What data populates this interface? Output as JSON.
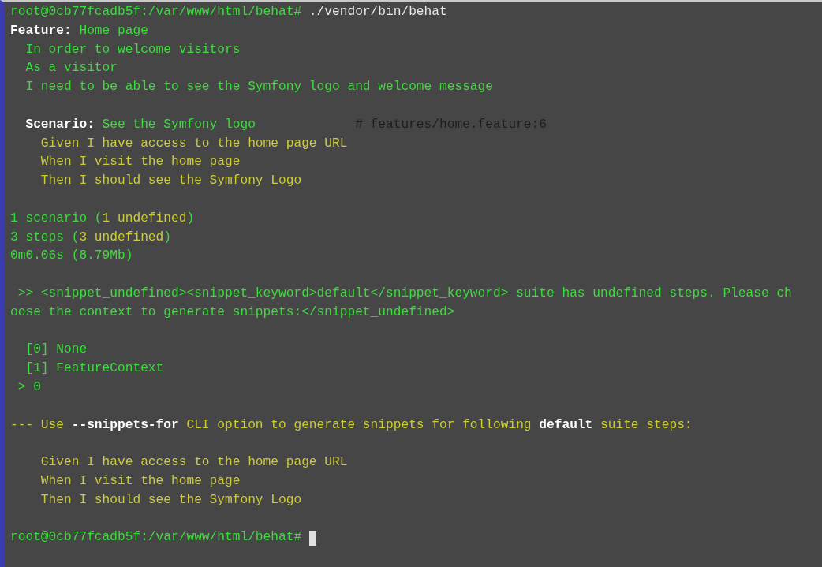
{
  "terminal": {
    "lines": [
      {
        "blank_before": false,
        "cursor": false,
        "segments": [
          {
            "kind": "green",
            "text": "root@0cb77fcadb5f:/var/www/html/behat#"
          },
          {
            "kind": "white",
            "text": " ./vendor/bin/behat"
          }
        ]
      },
      {
        "blank_before": false,
        "cursor": false,
        "segments": [
          {
            "kind": "white-bold",
            "text": "Feature:"
          },
          {
            "kind": "green",
            "text": " Home page"
          }
        ]
      },
      {
        "blank_before": false,
        "cursor": false,
        "segments": [
          {
            "kind": "green",
            "text": "  In order to welcome visitors"
          }
        ]
      },
      {
        "blank_before": false,
        "cursor": false,
        "segments": [
          {
            "kind": "green",
            "text": "  As a visitor"
          }
        ]
      },
      {
        "blank_before": false,
        "cursor": false,
        "segments": [
          {
            "kind": "green",
            "text": "  I need to be able to see the Symfony logo and welcome message"
          }
        ]
      },
      {
        "blank_before": true,
        "cursor": false,
        "segments": [
          {
            "kind": "white-bold",
            "text": "  Scenario:"
          },
          {
            "kind": "green",
            "text": " See the Symfony logo"
          },
          {
            "kind": "comment",
            "text": "             # features/home.feature:6"
          }
        ]
      },
      {
        "blank_before": false,
        "cursor": false,
        "segments": [
          {
            "kind": "yellow",
            "text": "    Given I have access to the home page URL"
          }
        ]
      },
      {
        "blank_before": false,
        "cursor": false,
        "segments": [
          {
            "kind": "yellow",
            "text": "    When I visit the home page"
          }
        ]
      },
      {
        "blank_before": false,
        "cursor": false,
        "segments": [
          {
            "kind": "yellow",
            "text": "    Then I should see the Symfony Logo"
          }
        ]
      },
      {
        "blank_before": true,
        "cursor": false,
        "segments": [
          {
            "kind": "green",
            "text": "1 scenario ("
          },
          {
            "kind": "yellow",
            "text": "1 undefined"
          },
          {
            "kind": "green",
            "text": ")"
          }
        ]
      },
      {
        "blank_before": false,
        "cursor": false,
        "segments": [
          {
            "kind": "green",
            "text": "3 steps ("
          },
          {
            "kind": "yellow",
            "text": "3 undefined"
          },
          {
            "kind": "green",
            "text": ")"
          }
        ]
      },
      {
        "blank_before": false,
        "cursor": false,
        "segments": [
          {
            "kind": "green",
            "text": "0m0.06s (8.79Mb)"
          }
        ]
      },
      {
        "blank_before": true,
        "cursor": false,
        "segments": [
          {
            "kind": "green",
            "text": " >> <snippet_undefined><snippet_keyword>default</snippet_keyword> suite has undefined steps. Please ch"
          }
        ]
      },
      {
        "blank_before": false,
        "cursor": false,
        "segments": [
          {
            "kind": "green",
            "text": "oose the context to generate snippets:</snippet_undefined>"
          }
        ]
      },
      {
        "blank_before": true,
        "cursor": false,
        "segments": [
          {
            "kind": "green",
            "text": "  [0] None"
          }
        ]
      },
      {
        "blank_before": false,
        "cursor": false,
        "segments": [
          {
            "kind": "green",
            "text": "  [1] FeatureContext"
          }
        ]
      },
      {
        "blank_before": false,
        "cursor": false,
        "segments": [
          {
            "kind": "green",
            "text": " > 0"
          }
        ]
      },
      {
        "blank_before": true,
        "cursor": false,
        "segments": [
          {
            "kind": "yellow",
            "text": "--- Use "
          },
          {
            "kind": "white-bold",
            "text": "--snippets-for"
          },
          {
            "kind": "yellow",
            "text": " CLI option to generate snippets for following "
          },
          {
            "kind": "white-bold",
            "text": "default"
          },
          {
            "kind": "yellow",
            "text": " suite steps:"
          }
        ]
      },
      {
        "blank_before": true,
        "cursor": false,
        "segments": [
          {
            "kind": "yellow",
            "text": "    Given I have access to the home page URL"
          }
        ]
      },
      {
        "blank_before": false,
        "cursor": false,
        "segments": [
          {
            "kind": "yellow",
            "text": "    When I visit the home page"
          }
        ]
      },
      {
        "blank_before": false,
        "cursor": false,
        "segments": [
          {
            "kind": "yellow",
            "text": "    Then I should see the Symfony Logo"
          }
        ]
      },
      {
        "blank_before": true,
        "cursor": true,
        "segments": [
          {
            "kind": "green",
            "text": "root@0cb77fcadb5f:/var/www/html/behat# "
          }
        ]
      }
    ]
  }
}
